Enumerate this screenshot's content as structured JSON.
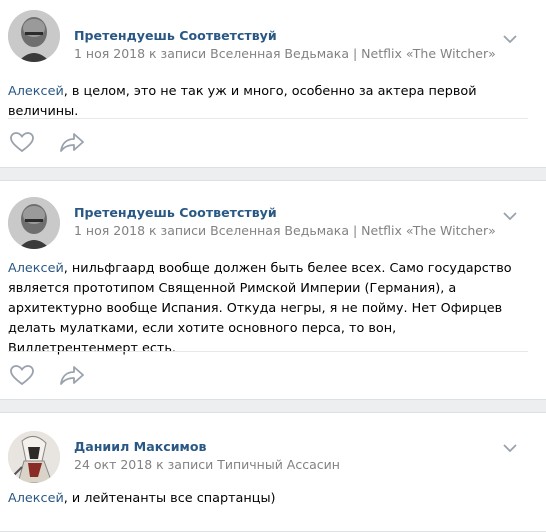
{
  "posts": [
    {
      "author": "Претендуешь Соответствуй",
      "meta": "1 ноя 2018 к записи Вселенная Ведьмака | Netflix «The Witcher»",
      "mention": "Алексей",
      "text": ", в целом, это не так уж и много, особенно за актера первой величины.",
      "avatar": "bald-man-avatar"
    },
    {
      "author": "Претендуешь Соответствуй",
      "meta": "1 ноя 2018 к записи Вселенная Ведьмака | Netflix «The Witcher»",
      "mention": "Алексей",
      "text": ", нильфгаард вообще должен быть белее всех. Само государство является прототипом Священной Римской Империи (Германия), а архитектурно вообще Испания. Откуда негры, я не пойму. Нет Офирцев делать мулатками, если хотите основного перса, то вон, Виллетрентенмерт есть.",
      "avatar": "bald-man-avatar"
    },
    {
      "author": "Даниил Максимов",
      "meta": "24 окт 2018 к записи Типичный Ассасин",
      "mention": "Алексей",
      "text": ", и лейтенанты все спартанцы)",
      "avatar": "assassin-avatar"
    }
  ],
  "icons": {
    "like": "heart-icon",
    "share": "share-arrow-icon",
    "menu": "chevron-down-icon"
  },
  "colors": {
    "link": "#2a5885",
    "meta": "#828282",
    "icon": "#99a2ad",
    "background": "#edeef0"
  }
}
